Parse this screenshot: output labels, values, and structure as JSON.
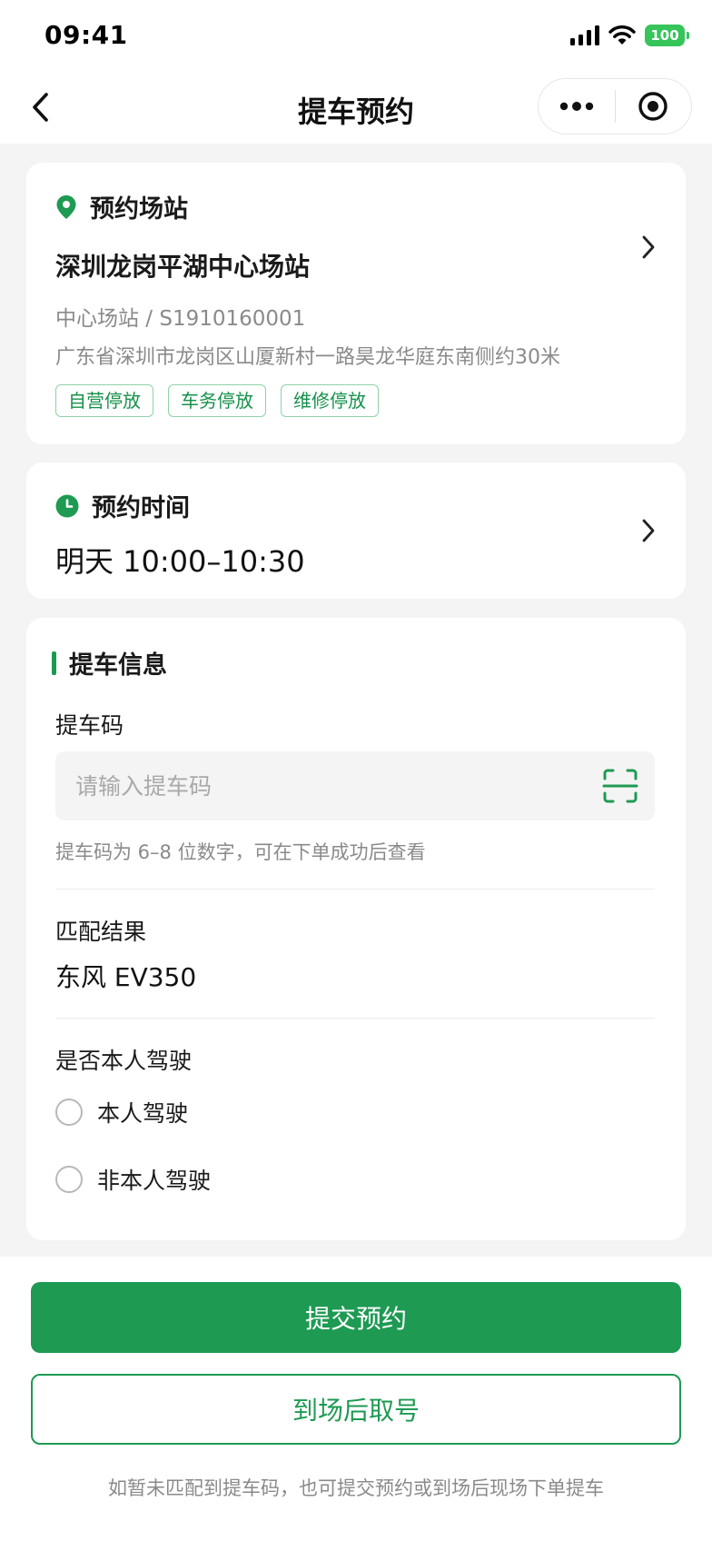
{
  "status_bar": {
    "time": "09:41",
    "battery": "100"
  },
  "nav": {
    "title": "提车预约"
  },
  "station": {
    "section_label": "预约场站",
    "name": "深圳龙岗平湖中心场站",
    "code": "中心场站 / S1910160001",
    "address": "广东省深圳市龙岗区山厦新村一路昊龙华庭东南侧约30米",
    "tags": [
      "自营停放",
      "车务停放",
      "维修停放"
    ]
  },
  "appointment_time": {
    "section_label": "预约时间",
    "value": "明天 10:00–10:30"
  },
  "pickup_info": {
    "section_title": "提车信息",
    "code_label": "提车码",
    "code_value": "",
    "code_placeholder": "请输入提车码",
    "code_hint": "提车码为 6–8 位数字，可在下单成功后查看",
    "match_label": "匹配结果",
    "match_value": "东风 EV350",
    "driver_label": "是否本人驾驶",
    "driver_options": [
      "本人驾驶",
      "非本人驾驶"
    ]
  },
  "actions": {
    "submit_label": "提交预约",
    "onsite_label": "到场后取号",
    "note": "如暂未匹配到提车码，也可提交预约或到场后现场下单提车"
  },
  "colors": {
    "accent": "#1e9a53",
    "tag_border": "#8fd2a7",
    "battery": "#36c45b"
  }
}
